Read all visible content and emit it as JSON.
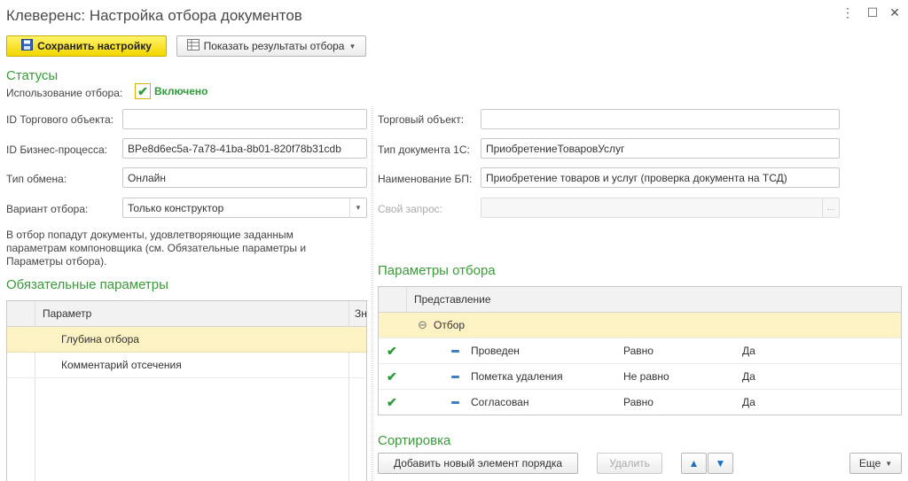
{
  "window": {
    "title": "Клеверенс: Настройка отбора документов"
  },
  "toolbar": {
    "save_label": "Сохранить настройку",
    "show_results_label": "Показать результаты отбора"
  },
  "statuses": {
    "heading": "Статусы",
    "usage_label": "Использование отбора:",
    "usage_value": "Включено",
    "usage_checked": true
  },
  "fields": {
    "trade_object_id_label": "ID Торгового объекта:",
    "trade_object_id_value": "",
    "bp_id_label": "ID Бизнес-процесса:",
    "bp_id_value": "BPe8d6ec5a-7a78-41ba-8b01-820f78b31cdb",
    "exchange_type_label": "Тип обмена:",
    "exchange_type_value": "Онлайн",
    "filter_variant_label": "Вариант отбора:",
    "filter_variant_value": "Только конструктор",
    "trade_object_label": "Торговый объект:",
    "trade_object_value": "",
    "doc_type_label": "Тип документа 1С:",
    "doc_type_value": "ПриобретениеТоваровУслуг",
    "bp_name_label": "Наименование БП:",
    "bp_name_value": "Приобретение товаров и услуг (проверка документа на ТСД)",
    "own_query_label": "Свой запрос:",
    "own_query_value": "",
    "own_query_button": "..."
  },
  "info_text": {
    "line1": "В отбор попадут документы, удовлетворяющие заданным",
    "line2": "параметрам компоновщика (см. Обязательные параметры и",
    "line3": "Параметры отбора)."
  },
  "required_params": {
    "heading": "Обязательные параметры",
    "columns": [
      "Параметр",
      "Зн"
    ],
    "rows": [
      {
        "name": "Глубина отбора",
        "selected": true
      },
      {
        "name": "Комментарий отсечения",
        "selected": false
      }
    ]
  },
  "filter_params": {
    "heading": "Параметры отбора",
    "column": "Представление",
    "group_label": "Отбор",
    "group_symbol": "⊖",
    "rows": [
      {
        "checked": true,
        "field": "Проведен",
        "comparison": "Равно",
        "value": "Да"
      },
      {
        "checked": true,
        "field": "Пометка удаления",
        "comparison": "Не равно",
        "value": "Да"
      },
      {
        "checked": true,
        "field": "Согласован",
        "comparison": "Равно",
        "value": "Да"
      }
    ]
  },
  "sorting": {
    "heading": "Сортировка",
    "add_label": "Добавить новый элемент порядка",
    "delete_label": "Удалить",
    "more_label": "Еще"
  },
  "colors": {
    "accent_green": "#3a9a3a",
    "primary_yellow": "#f2d600",
    "selection": "#fdf2c4"
  }
}
